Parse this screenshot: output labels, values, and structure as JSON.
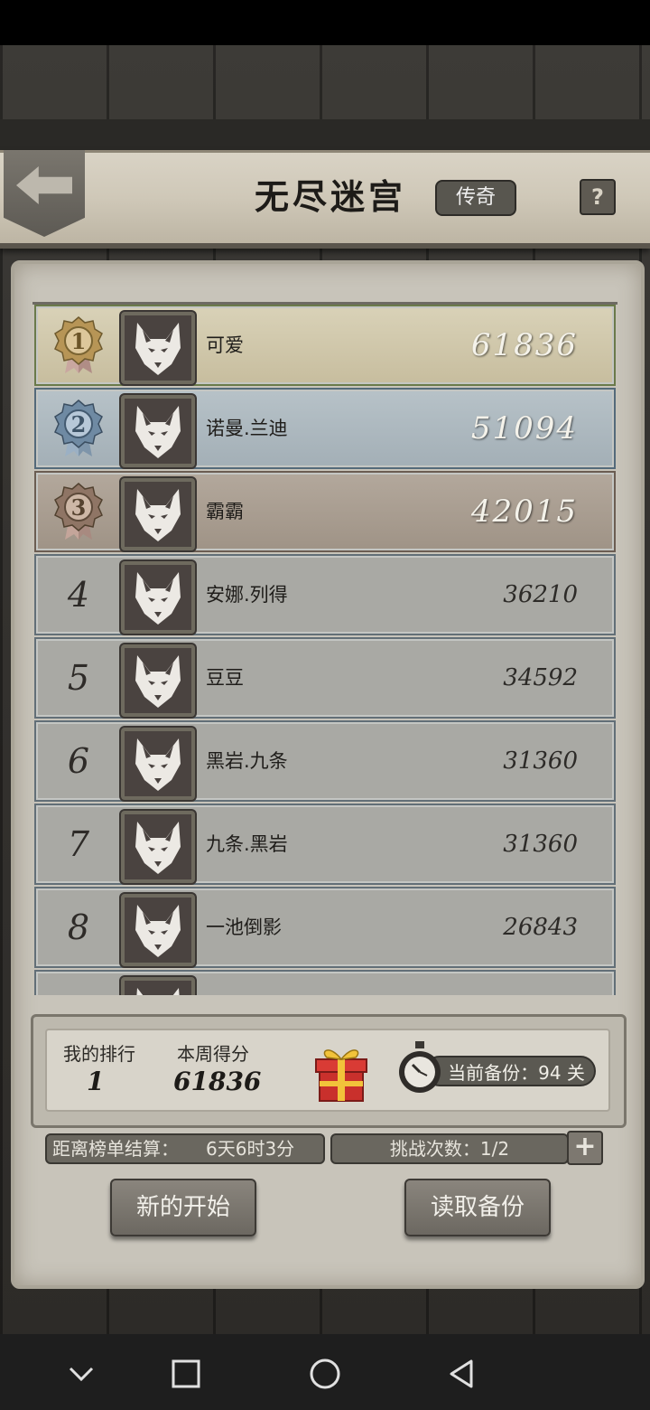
{
  "header": {
    "title": "无尽迷宫",
    "mode_badge": "传奇",
    "help_label": "?"
  },
  "leaderboard": [
    {
      "rank": "1",
      "name": "可爱",
      "score": "61836",
      "tier": "gold"
    },
    {
      "rank": "2",
      "name": "诺曼.兰迪",
      "score": "51094",
      "tier": "silver"
    },
    {
      "rank": "3",
      "name": "霸霸",
      "score": "42015",
      "tier": "bronze"
    },
    {
      "rank": "4",
      "name": "安娜.列得",
      "score": "36210",
      "tier": "normal"
    },
    {
      "rank": "5",
      "name": "豆豆",
      "score": "34592",
      "tier": "normal"
    },
    {
      "rank": "6",
      "name": "黑岩.九条",
      "score": "31360",
      "tier": "normal"
    },
    {
      "rank": "7",
      "name": "九条.黑岩",
      "score": "31360",
      "tier": "normal"
    },
    {
      "rank": "8",
      "name": "一池倒影",
      "score": "26843",
      "tier": "normal"
    }
  ],
  "my_stats": {
    "rank_label": "我的排行",
    "rank_value": "1",
    "score_label": "本周得分",
    "score_value": "61836",
    "backup_text": "当前备份：94 关"
  },
  "footer": {
    "countdown_label": "距离榜单结算：",
    "countdown_value": "6天6时3分",
    "challenges_text": "挑战次数：1/2",
    "plus_label": "+",
    "new_start_label": "新的开始",
    "load_backup_label": "读取备份"
  },
  "icons": {
    "avatar": "wolf-icon",
    "back": "back-arrow-icon",
    "gift": "gift-icon",
    "timer": "stopwatch-icon"
  }
}
